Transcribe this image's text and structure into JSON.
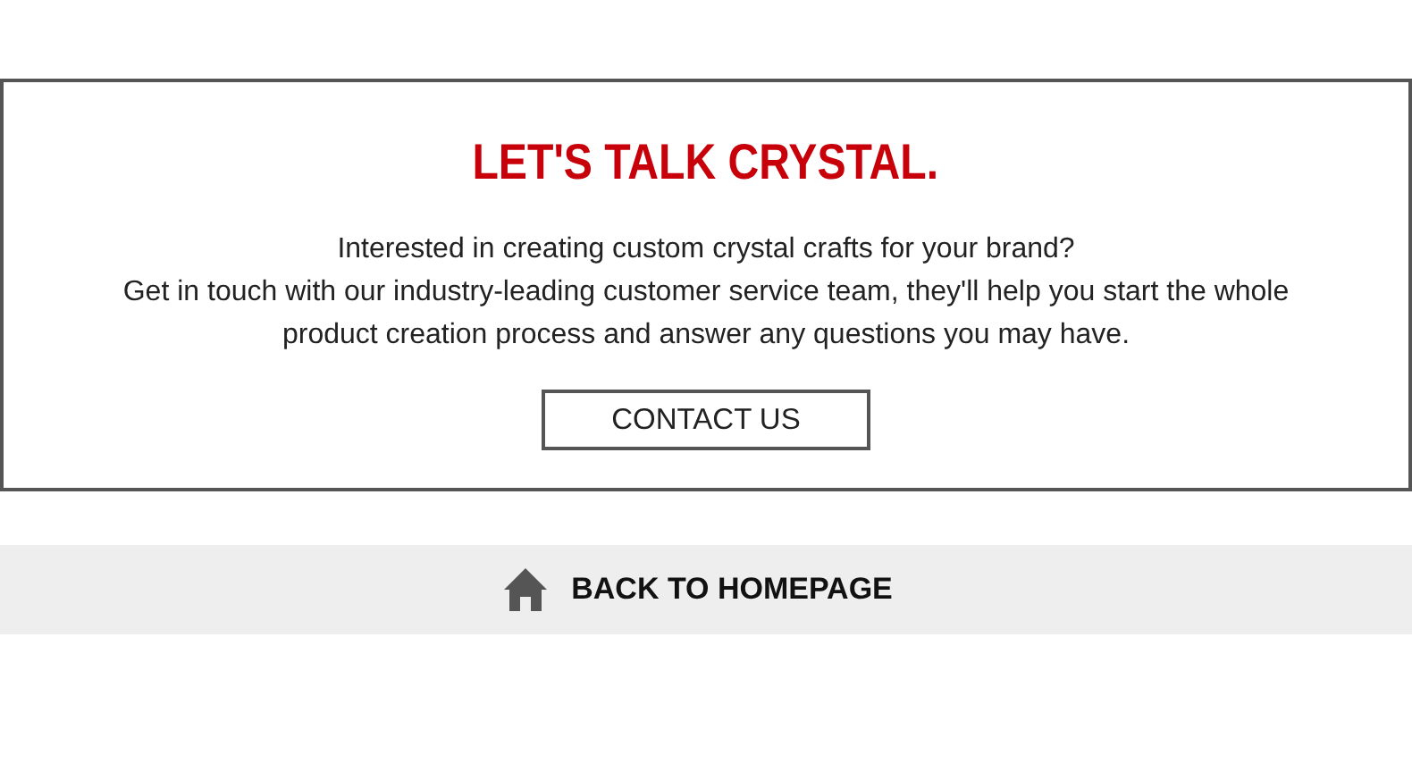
{
  "contact_panel": {
    "title": "LET'S TALK CRYSTAL.",
    "paragraphs": [
      "Interested in creating custom crystal crafts for your brand?",
      "Get in touch with our industry-leading customer service team, they'll help you start the whole product creation process and answer any questions you may have."
    ],
    "button": "CONTACT US"
  },
  "back_link": {
    "label": "BACK TO HOMEPAGE"
  }
}
